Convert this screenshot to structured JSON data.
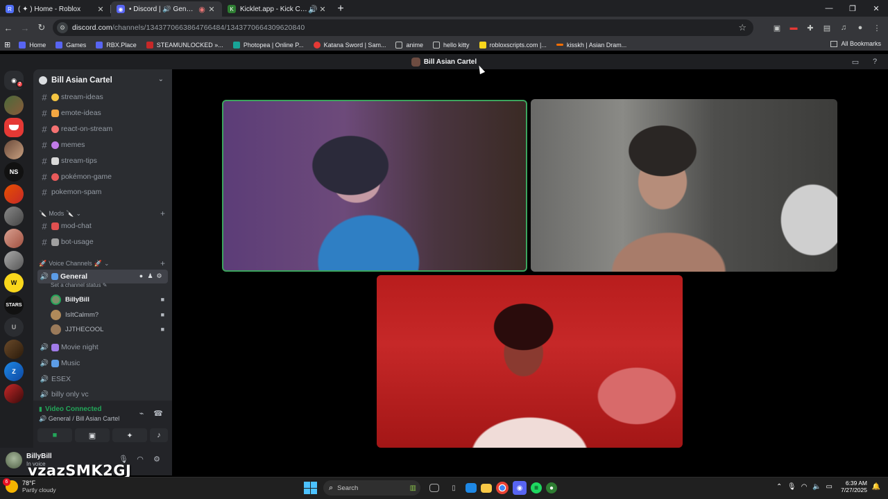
{
  "browser": {
    "tabs": [
      {
        "label": "( ✦ ) Home - Roblox",
        "icon": "roblox-icon",
        "color": "#4f6ef7"
      },
      {
        "label": "• Discord | 🔊 General | Bill",
        "icon": "discord-icon",
        "color": "#5865f2"
      },
      {
        "label": "Kicklet.app - Kick Chatbot",
        "icon": "kicklet-icon",
        "color": "#53fc18"
      }
    ],
    "url": {
      "host": "discord.com",
      "path": "/channels/1343770663864766484/1343770664309620840"
    },
    "bookmarks": [
      {
        "label": "Home",
        "color": "#5865f2"
      },
      {
        "label": "Games",
        "color": "#5865f2"
      },
      {
        "label": "RBX.Place",
        "color": "#5865f2"
      },
      {
        "label": "STEAMUNLOCKED »...",
        "color": "#c62828"
      },
      {
        "label": "Photopea | Online P...",
        "color": "#18a497"
      },
      {
        "label": "Katana Sword | Sam...",
        "color": "#e53935"
      },
      {
        "label": "anime",
        "color": "folder"
      },
      {
        "label": "hello kitty",
        "color": "folder"
      },
      {
        "label": "robloxscripts.com |...",
        "color": "#f9d71c"
      },
      {
        "label": "kisskh | Asian Dram...",
        "color": "#ff6f00"
      }
    ],
    "all_bookmarks": "All Bookmarks"
  },
  "discord": {
    "title": "Bill Asian Cartel",
    "server_name": "Bill Asian Cartel",
    "text_channels": [
      {
        "name": "stream-ideas",
        "emoji_color": "#f4c542"
      },
      {
        "name": "emote-ideas",
        "emoji_color": "#f4a742"
      },
      {
        "name": "react-on-stream",
        "emoji_color": "#f47272"
      },
      {
        "name": "memes",
        "emoji_color": "#c17be8"
      },
      {
        "name": "stream-tips",
        "emoji_color": "#d9d9d9"
      },
      {
        "name": "pokémon-game",
        "emoji_color": "#e85a5a"
      },
      {
        "name": "pokemon-spam",
        "emoji_color": ""
      }
    ],
    "mods_category": "Mods",
    "mod_channels": [
      {
        "name": "mod-chat",
        "emoji_color": "#e05050"
      },
      {
        "name": "bot-usage",
        "emoji_color": "#a0a0a0"
      }
    ],
    "voice_category": "Voice Channels",
    "active_voice": {
      "name": "General",
      "status_placeholder": "Set a channel status"
    },
    "voice_users": [
      {
        "name": "BillyBill",
        "avatar_color": "#7a8f6a"
      },
      {
        "name": "IsItCalmm?",
        "avatar_color": "#b08a5a"
      },
      {
        "name": "JJTHECOOL",
        "avatar_color": "#9a7a5a"
      }
    ],
    "other_voice": [
      {
        "name": "Movie night"
      },
      {
        "name": "Music"
      },
      {
        "name": "ESEX"
      },
      {
        "name": "billy only vc"
      }
    ],
    "voice_panel": {
      "status": "Video Connected",
      "sub": "General / Bill Asian Cartel"
    },
    "user": {
      "name": "BillyBill",
      "status": "In voice"
    },
    "guild_badge": "2",
    "guild_labels": [
      "NS",
      "STARS",
      "U"
    ]
  },
  "overlay": {
    "watermark": "vzazSMK2GJ"
  },
  "taskbar": {
    "weather_temp": "78°F",
    "weather_desc": "Partly cloudy",
    "weather_badge": "6",
    "search_placeholder": "Search",
    "time": "6:39 AM",
    "date": "7/27/2025"
  }
}
